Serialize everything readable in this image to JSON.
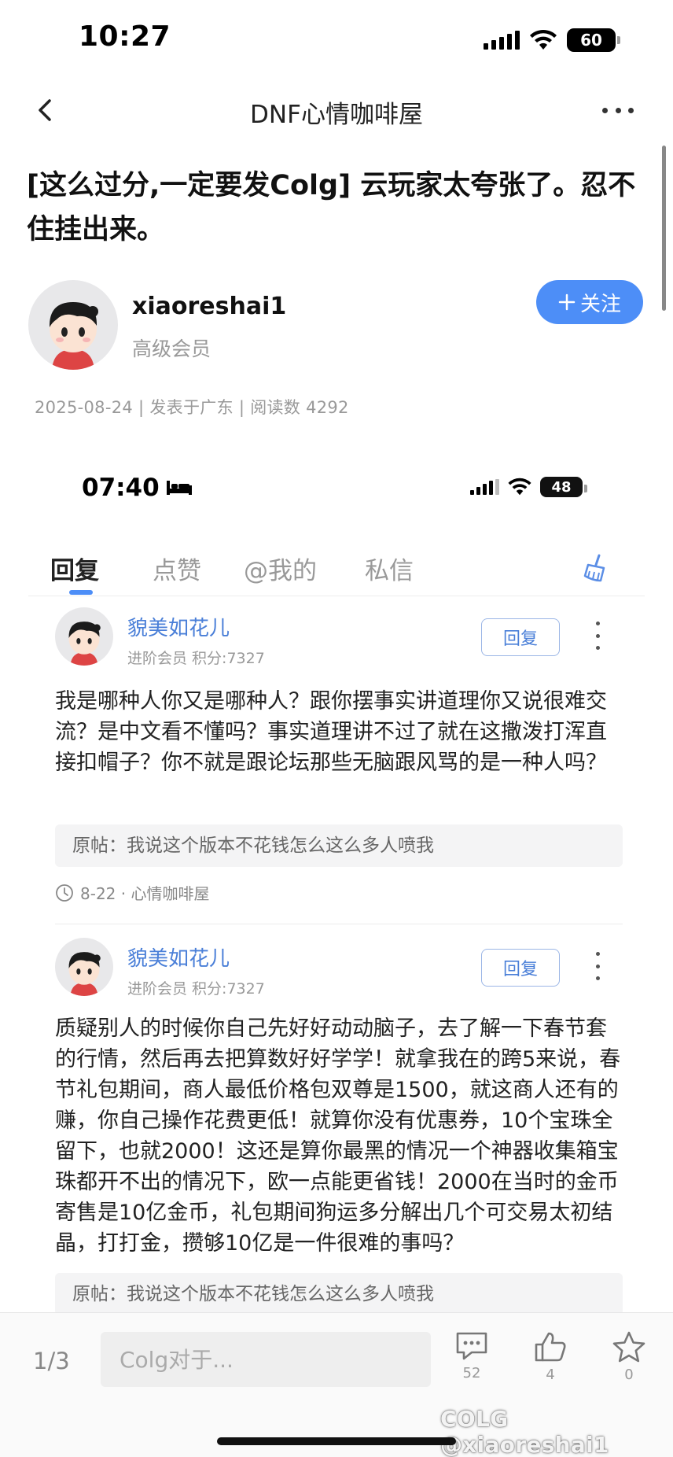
{
  "status_bar": {
    "time": "10:27",
    "battery": "60"
  },
  "nav": {
    "title": "DNF心情咖啡屋"
  },
  "post": {
    "title": "[这么过分,一定要发Colg] 云玩家太夸张了。忍不住挂出来。",
    "author": {
      "name": "xiaoreshai1",
      "level": "高级会员"
    },
    "follow_label": "关注",
    "meta": "2025-08-24 | 发表于广东 | 阅读数 4292"
  },
  "embedded": {
    "status_bar": {
      "time": "07:40",
      "battery": "48"
    },
    "tabs": [
      "回复",
      "点赞",
      "@我的",
      "私信"
    ],
    "active_tab": "回复",
    "comments": [
      {
        "name": "貌美如花儿",
        "meta": "进阶会员 积分:7327",
        "reply_label": "回复",
        "body": "我是哪种人你又是哪种人？跟你摆事实讲道理你又说很难交流？是中文看不懂吗？事实道理讲不过了就在这撒泼打浑直接扣帽子？你不就是跟论坛那些无脑跟风骂的是一种人吗？",
        "quote": "原帖：我说这个版本不花钱怎么这么多人喷我",
        "time": "8-22 · 心情咖啡屋"
      },
      {
        "name": "貌美如花儿",
        "meta": "进阶会员 积分:7327",
        "reply_label": "回复",
        "body": "质疑别人的时候你自己先好好动动脑子，去了解一下春节套的行情，然后再去把算数好好学学！就拿我在的跨5来说，春节礼包期间，商人最低价格包双尊是1500，就这商人还有的赚，你自己操作花费更低！就算你没有优惠券，10个宝珠全留下，也就2000！这还是算你最黑的情况一个神器收集箱宝珠都开不出的情况下，欧一点能更省钱！2000在当时的金币寄售是10亿金币，礼包期间狗运多分解出几个可交易太初结晶，打打金，攒够10亿是一件很难的事吗？",
        "quote": "原帖：我说这个版本不花钱怎么这么多人喷我"
      }
    ]
  },
  "bottom": {
    "page": "1/3",
    "input_placeholder": "Colg对于...",
    "comments_count": "52",
    "likes_count": "4",
    "favorites_count": "0",
    "watermark": "COLG @xiaoreshai1"
  },
  "colors": {
    "accent": "#4d8ef7",
    "link": "#4a7fd8"
  },
  "icons": [
    "back-icon",
    "more-icon",
    "signal-icon",
    "wifi-icon",
    "battery-icon",
    "bed-icon",
    "broom-icon",
    "clock-icon",
    "comment-icon",
    "thumbs-up-icon",
    "star-icon"
  ]
}
